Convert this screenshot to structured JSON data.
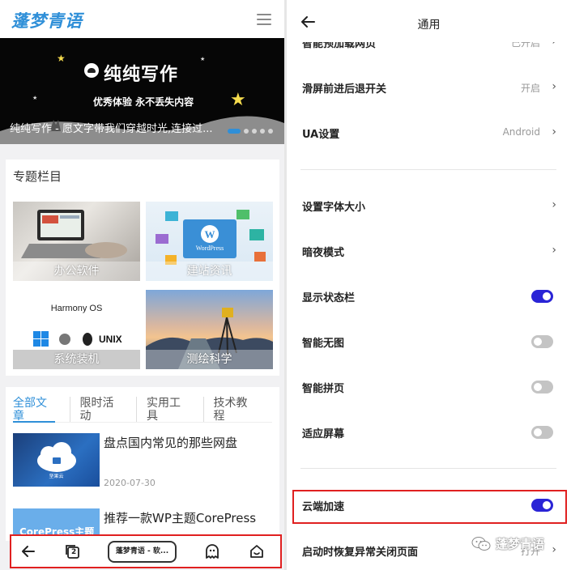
{
  "left": {
    "logo": "蓬梦青语",
    "banner": {
      "title": "纯纯写作",
      "subtitle": "优秀体验 永不丢失内容",
      "caption": "纯纯写作 - 愿文字带我们穿越时光,连接过...",
      "slide_count": 5,
      "active_slide": 1
    },
    "topics": {
      "heading": "专题栏目",
      "tiles": [
        {
          "label": "办公软件"
        },
        {
          "label": "建站资讯",
          "logo_text": "WordPress"
        },
        {
          "label": "系统装机",
          "top_text": "Harmony OS",
          "os_text": "UNIX"
        },
        {
          "label": "测绘科学"
        }
      ]
    },
    "articles": {
      "tabs": [
        "全部文章",
        "限时活动",
        "实用工具",
        "技术教程"
      ],
      "active_tab": 0,
      "items": [
        {
          "title": "盘点国内常见的那些网盘",
          "date": "2020-07-30",
          "thumb_text": "坚果云"
        },
        {
          "title": "推荐一款WP主题CorePress",
          "thumb_text": "CorePress主题"
        }
      ]
    },
    "bottom_bar": {
      "back_icon": "arrow-left-icon",
      "tabs_icon": "tabs-icon",
      "tabs_count": "2",
      "page_pill": "蓬梦青语 - 软...",
      "ghost_icon": "ghost-icon",
      "home_icon": "home-icon"
    }
  },
  "right": {
    "title": "通用",
    "top_cut_row": {
      "label": "智能预加载网页",
      "value": "已开启"
    },
    "rows": [
      {
        "label": "滑屏前进后退开关",
        "value": "开启",
        "type": "link"
      },
      {
        "label": "UA设置",
        "value": "Android",
        "type": "link"
      },
      {
        "label": "设置字体大小",
        "type": "link"
      },
      {
        "label": "暗夜模式",
        "type": "link"
      },
      {
        "label": "显示状态栏",
        "type": "toggle",
        "on": true
      },
      {
        "label": "智能无图",
        "type": "toggle",
        "on": false
      },
      {
        "label": "智能拼页",
        "type": "toggle",
        "on": false
      },
      {
        "label": "适应屏幕",
        "type": "toggle",
        "on": false
      },
      {
        "label": "云端加速",
        "type": "toggle",
        "on": true
      },
      {
        "label": "启动时恢复异常关闭页面",
        "value": "打开",
        "type": "link"
      }
    ],
    "chevron": "›"
  },
  "watermark": {
    "text": "蓬梦青语",
    "icon": "wechat-icon"
  },
  "colors": {
    "accent": "#2f8fd8",
    "toggle_on": "#2a24d6",
    "highlight": "#e02020"
  }
}
